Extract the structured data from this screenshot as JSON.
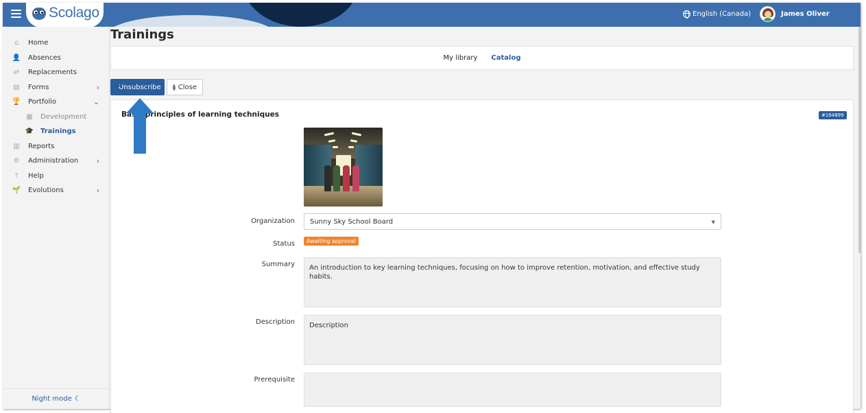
{
  "app": {
    "logo_text": "Scolago",
    "language": "English (Canada)",
    "user_name": "James Oliver"
  },
  "sidebar": {
    "items": [
      {
        "label": "Home",
        "icon": "home-icon"
      },
      {
        "label": "Absences",
        "icon": "user-absence-icon"
      },
      {
        "label": "Replacements",
        "icon": "replacements-icon"
      },
      {
        "label": "Forms",
        "icon": "forms-icon"
      },
      {
        "label": "Portfolio",
        "icon": "trophy-icon"
      },
      {
        "label": "Development",
        "icon": "development-icon"
      },
      {
        "label": "Trainings",
        "icon": "graduation-cap-icon"
      },
      {
        "label": "Reports",
        "icon": "reports-icon"
      },
      {
        "label": "Administration",
        "icon": "gear-icon"
      },
      {
        "label": "Help",
        "icon": "help-icon"
      },
      {
        "label": "Evolutions",
        "icon": "sprout-icon"
      }
    ],
    "night_mode": "Night mode"
  },
  "page": {
    "title": "Trainings",
    "tabs": [
      "My library",
      "Catalog"
    ],
    "active_tab": "Catalog"
  },
  "toolbar": {
    "unsubscribe_label": "Unsubscribe",
    "close_label": "Close"
  },
  "training": {
    "title": "Basic principles of learning techniques",
    "id": "#164899",
    "organization_label": "Organization",
    "organization_value": "Sunny Sky School Board",
    "status_label": "Status",
    "status_value": "Awaiting approval",
    "summary_label": "Summary",
    "summary_value": "An introduction to key learning techniques, focusing on how to improve retention, motivation, and effective study habits.",
    "description_label": "Description",
    "description_value": "Description",
    "prerequisite_label": "Prerequisite",
    "prerequisite_value": ""
  },
  "colors": {
    "header_blue": "#3d6fae",
    "primary_button": "#2a5d9c",
    "status_orange": "#f0842c",
    "arrow_blue": "#2f7ac4"
  }
}
